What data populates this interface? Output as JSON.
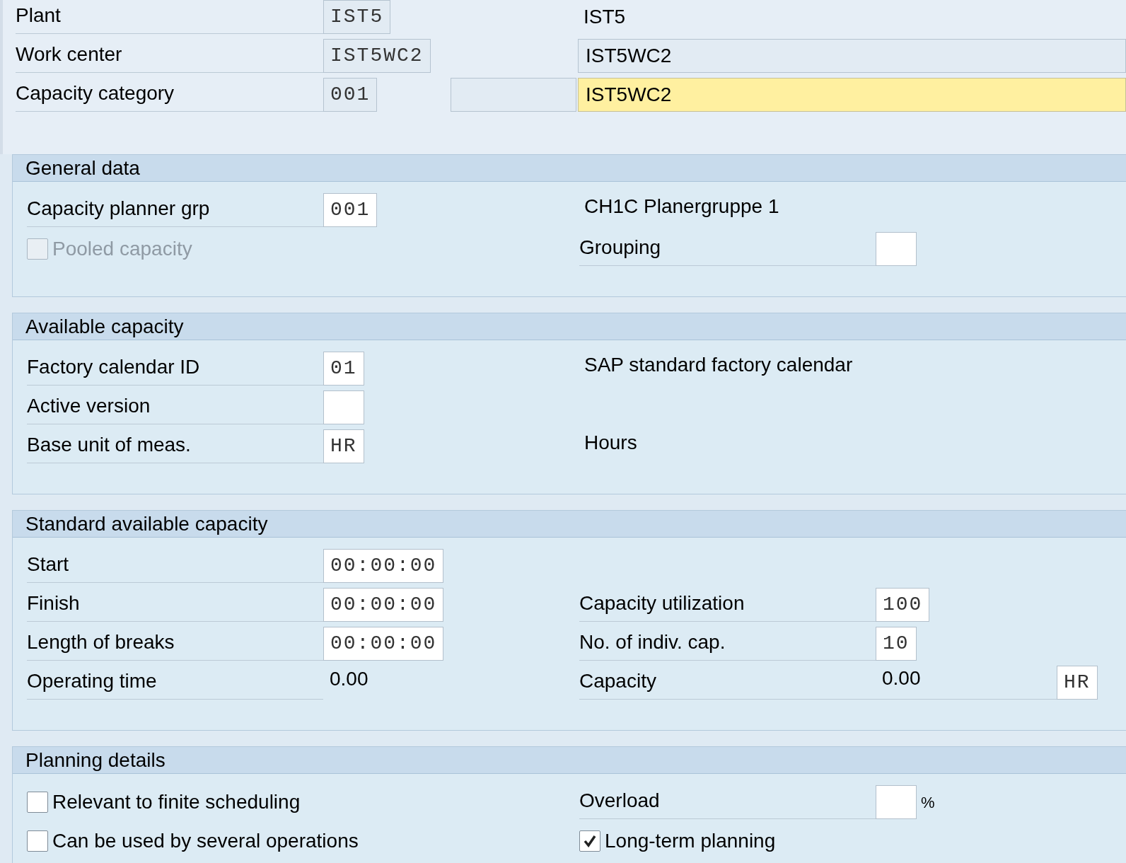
{
  "header_fields": [
    {
      "label": "Plant",
      "value": "IST5",
      "description": "IST5",
      "kind": "text",
      "blank_field": false
    },
    {
      "label": "Work center",
      "value": "IST5WC2",
      "description": "IST5WC2",
      "kind": "boxed",
      "blank_field": false
    },
    {
      "label": "Capacity category",
      "value": "001",
      "description": "IST5WC2",
      "kind": "highlighted",
      "blank_field": true
    }
  ],
  "sections": [
    {
      "title": "General data",
      "rows": [
        {
          "left": {
            "kind": "field",
            "label": "Capacity planner grp",
            "value": "001"
          },
          "right": {
            "kind": "description",
            "text": "CH1C Planergruppe 1"
          }
        },
        {
          "left": {
            "kind": "checkbox",
            "label": "Pooled capacity",
            "checked": false,
            "disabled": true
          },
          "right": {
            "kind": "field",
            "label": "Grouping"
          }
        }
      ]
    },
    {
      "title": "Available capacity",
      "rows": [
        {
          "left": {
            "kind": "field",
            "label": "Factory calendar ID",
            "value": "01"
          },
          "right": {
            "kind": "description",
            "text": "SAP standard factory calendar"
          }
        },
        {
          "left": {
            "kind": "field",
            "label": "Active version"
          }
        },
        {
          "left": {
            "kind": "field",
            "label": "Base unit of meas.",
            "value": "HR"
          },
          "right": {
            "kind": "description",
            "text": "Hours"
          }
        }
      ]
    },
    {
      "title": "Standard available capacity",
      "rows": [
        {
          "left": {
            "kind": "field",
            "label": "Start",
            "value": "00:00:00"
          }
        },
        {
          "left": {
            "kind": "field",
            "label": "Finish",
            "value": "00:00:00"
          },
          "right": {
            "kind": "field",
            "label": "Capacity utilization",
            "value": "100"
          }
        },
        {
          "left": {
            "kind": "field",
            "label": "Length of breaks",
            "value": "00:00:00"
          },
          "right": {
            "kind": "field",
            "label": "No. of indiv. cap.",
            "value": "10"
          }
        },
        {
          "left": {
            "kind": "readout",
            "label": "Operating time",
            "value": "0.00"
          },
          "right": {
            "kind": "readout",
            "label": "Capacity",
            "value": "0.00",
            "unit": "HR"
          }
        }
      ]
    },
    {
      "title": "Planning details",
      "rows": [
        {
          "left": {
            "kind": "checkbox",
            "label": "Relevant to finite scheduling",
            "checked": false,
            "disabled": false
          },
          "right": {
            "kind": "field",
            "label": "Overload",
            "suffix": "%"
          }
        },
        {
          "left": {
            "kind": "checkbox",
            "label": "Can be used by several operations",
            "checked": false,
            "disabled": false
          },
          "right": {
            "kind": "checkbox",
            "label": "Long-term planning",
            "checked": true,
            "disabled": false
          }
        }
      ]
    }
  ]
}
